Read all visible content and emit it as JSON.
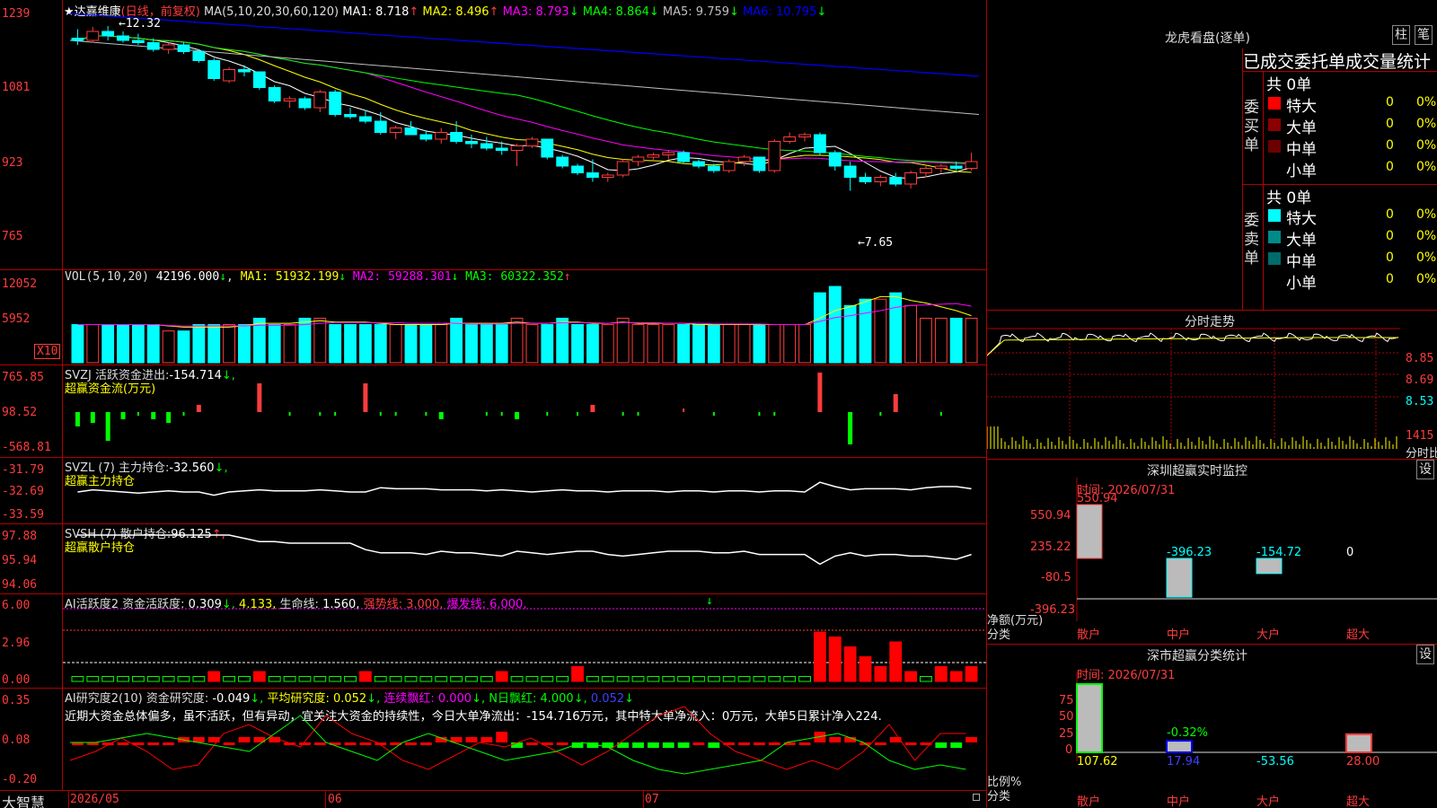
{
  "main": {
    "title": "★达嘉维康",
    "period": "(日线，前复权)",
    "ma_label": "MA(5,10,20,30,60,120)",
    "ma": [
      {
        "label": "MA1:",
        "value": "8.718",
        "arrow": "↑",
        "color": "#ffffff"
      },
      {
        "label": "MA2:",
        "value": "8.496",
        "arrow": "↑",
        "color": "#ffff00"
      },
      {
        "label": "MA3:",
        "value": "8.793",
        "arrow": "↓",
        "color": "#ff00ff"
      },
      {
        "label": "MA4:",
        "value": "8.864",
        "arrow": "↓",
        "color": "#00ff00"
      },
      {
        "label": "MA5:",
        "value": "9.759",
        "arrow": "↓",
        "color": "#c0c0c0"
      },
      {
        "label": "MA6:",
        "value": "10.795",
        "arrow": "↓",
        "color": "#0000ff"
      }
    ],
    "yticks": [
      "1239",
      "1081",
      "923",
      "765"
    ],
    "high_label": "12.32",
    "low_label": "7.65"
  },
  "vol": {
    "label": "VOL(5,10,20)",
    "value": "42196.000",
    "arrow": "↓",
    "ma": [
      {
        "label": "MA1:",
        "value": "51932.199",
        "arrow": "↓",
        "color": "#ffff00"
      },
      {
        "label": "MA2:",
        "value": "59288.301",
        "arrow": "↓",
        "color": "#ff00ff"
      },
      {
        "label": "MA3:",
        "value": "60322.352",
        "arrow": "↑",
        "color": "#00ff00"
      }
    ],
    "yticks": [
      "12052",
      "5952"
    ],
    "unit": "X10"
  },
  "svzj": {
    "label": "SVZJ  活跃资金进出:",
    "value": "-154.714",
    "arrow": "↓,",
    "sub": "超赢资金流(万元)",
    "yticks": [
      "765.85",
      "98.52",
      "-568.81"
    ]
  },
  "svzl": {
    "label": "SVZL (7) 主力持仓:",
    "value": "-32.560",
    "arrow": "↓,",
    "sub": "超赢主力持仓",
    "yticks": [
      "-31.79",
      "-32.69",
      "-33.59"
    ]
  },
  "svsh": {
    "label": "SVSH (7) 散户持仓:",
    "value": "96.125",
    "arrow": "↑,",
    "sub": "超赢散户持仓",
    "yticks": [
      "97.88",
      "95.94",
      "94.06"
    ]
  },
  "ai1": {
    "label": "AI活跃度2 资金活跃度:",
    "v1": "0.309",
    "a1": "↓,",
    "v2": "4.133,",
    "life_label": "生命线:",
    "life": "1.560,",
    "strong": "强势线: 3.000,",
    "burst": "爆发线: 6.000,",
    "flag": "↓",
    "yticks": [
      "6.00",
      "2.96",
      "0.00"
    ]
  },
  "ai2": {
    "label": "AI研究度2(10) 资金研究度:",
    "v1": "-0.049",
    "a1": "↓,",
    "avg": "平均研究度: 0.052",
    "avg_a": "↓,",
    "red": "连续飘红: 0.000",
    "red_a": "↓,",
    "nred": "N日飘红: 4.000",
    "nred_a": "↓,",
    "last": "0.052",
    "last_a": "↓",
    "text": "近期大资金总体偏多，虽不活跃，但有异动，宜关注大资金的持续性，今日大单净流出：-154.716万元，其中特大单净流入：0万元，大单5日累计净入224.",
    "yticks": [
      "0.35",
      "0.08",
      "-0.20"
    ]
  },
  "footer": {
    "brand": "大智慧",
    "dates": [
      "2026/05",
      "06",
      "07"
    ]
  },
  "dragon": {
    "title": "龙虎看盘(逐单)",
    "btn1": "柱",
    "btn2": "笔",
    "header": "已成交委托单成交量统计",
    "buy_label": "委买单",
    "sell_label": "委卖单",
    "buy_total": "共 0单",
    "sell_total": "共 0单",
    "buy_rows": [
      {
        "name": "特大",
        "qty": "0",
        "pct": "0%",
        "color": "#ff0000"
      },
      {
        "name": "大单",
        "qty": "0",
        "pct": "0%",
        "color": "#8b0000"
      },
      {
        "name": "中单",
        "qty": "0",
        "pct": "0%",
        "color": "#6b0000"
      },
      {
        "name": "小单",
        "qty": "0",
        "pct": "0%",
        "color": "#000000"
      }
    ],
    "sell_rows": [
      {
        "name": "特大",
        "qty": "0",
        "pct": "0%",
        "color": "#00ffff"
      },
      {
        "name": "大单",
        "qty": "0",
        "pct": "0%",
        "color": "#008b8b"
      },
      {
        "name": "中单",
        "qty": "0",
        "pct": "0%",
        "color": "#006b6b"
      },
      {
        "name": "小单",
        "qty": "0",
        "pct": "0%",
        "color": "#000000"
      }
    ]
  },
  "intraday": {
    "title": "分时走势",
    "yticks": [
      "8.85",
      "8.69",
      "8.53"
    ],
    "vol_tick": "1415",
    "vol_label": "分时比"
  },
  "monitor": {
    "title": "深圳超赢实时监控",
    "btn": "设",
    "time": "时间: 2026/07/31",
    "yticks": [
      "550.94",
      "235.22",
      "-80.5",
      "-396.23"
    ],
    "ylabel1": "净额(万元)",
    "ylabel2": "分类",
    "cats": [
      "散户",
      "中户",
      "大户",
      "超大"
    ]
  },
  "classify": {
    "title": "深市超赢分类统计",
    "btn": "设",
    "time": "时间: 2026/07/31",
    "yticks": [
      "75",
      "50",
      "25",
      "0"
    ],
    "ylabel1": "比例%",
    "ylabel2": "分类",
    "cats": [
      "散户",
      "中户",
      "大户",
      "超大"
    ]
  },
  "chart_data": [
    {
      "type": "candlestick",
      "title": "达嘉维康 日线 前复权",
      "note": "price axis labels as displayed (x100)",
      "ylim": [
        7.4,
        12.5
      ],
      "ohlc": [
        [
          12.05,
          12.25,
          11.9,
          12.0
        ],
        [
          12.0,
          12.3,
          11.95,
          12.2
        ],
        [
          12.2,
          12.32,
          12.0,
          12.1
        ],
        [
          12.1,
          12.2,
          11.95,
          12.0
        ],
        [
          12.0,
          12.15,
          11.9,
          11.95
        ],
        [
          11.95,
          12.05,
          11.75,
          11.8
        ],
        [
          11.8,
          11.95,
          11.7,
          11.9
        ],
        [
          11.9,
          11.95,
          11.7,
          11.75
        ],
        [
          11.75,
          11.8,
          11.5,
          11.55
        ],
        [
          11.55,
          11.6,
          11.1,
          11.15
        ],
        [
          11.1,
          11.4,
          11.05,
          11.35
        ],
        [
          11.35,
          11.45,
          11.2,
          11.3
        ],
        [
          11.3,
          11.3,
          10.9,
          10.95
        ],
        [
          10.95,
          11.0,
          10.6,
          10.65
        ],
        [
          10.65,
          10.75,
          10.5,
          10.7
        ],
        [
          10.7,
          10.75,
          10.45,
          10.5
        ],
        [
          10.5,
          10.9,
          10.4,
          10.85
        ],
        [
          10.85,
          10.9,
          10.3,
          10.35
        ],
        [
          10.35,
          10.5,
          10.25,
          10.3
        ],
        [
          10.3,
          10.45,
          10.15,
          10.2
        ],
        [
          10.2,
          10.4,
          9.9,
          9.95
        ],
        [
          9.95,
          10.1,
          9.8,
          10.05
        ],
        [
          10.05,
          10.2,
          9.9,
          9.9
        ],
        [
          9.9,
          10.0,
          9.75,
          9.8
        ],
        [
          9.8,
          10.05,
          9.7,
          9.95
        ],
        [
          9.95,
          10.2,
          9.7,
          9.75
        ],
        [
          9.75,
          9.9,
          9.6,
          9.7
        ],
        [
          9.7,
          9.85,
          9.55,
          9.6
        ],
        [
          9.6,
          9.75,
          9.45,
          9.55
        ],
        [
          9.55,
          9.7,
          9.2,
          9.65
        ],
        [
          9.65,
          9.85,
          9.6,
          9.8
        ],
        [
          9.8,
          9.8,
          9.35,
          9.4
        ],
        [
          9.4,
          9.45,
          9.15,
          9.2
        ],
        [
          9.2,
          9.25,
          9.0,
          9.05
        ],
        [
          9.05,
          9.35,
          8.85,
          8.95
        ],
        [
          8.95,
          9.05,
          8.85,
          9.0
        ],
        [
          9.0,
          9.35,
          8.95,
          9.3
        ],
        [
          9.3,
          9.45,
          9.2,
          9.4
        ],
        [
          9.4,
          9.5,
          9.3,
          9.45
        ],
        [
          9.45,
          9.55,
          9.35,
          9.5
        ],
        [
          9.5,
          9.55,
          9.25,
          9.3
        ],
        [
          9.3,
          9.35,
          9.15,
          9.2
        ],
        [
          9.2,
          9.25,
          9.05,
          9.1
        ],
        [
          9.1,
          9.35,
          9.05,
          9.3
        ],
        [
          9.3,
          9.45,
          9.2,
          9.4
        ],
        [
          9.4,
          9.4,
          9.05,
          9.1
        ],
        [
          9.1,
          9.8,
          9.05,
          9.75
        ],
        [
          9.75,
          9.95,
          9.7,
          9.85
        ],
        [
          9.85,
          9.95,
          9.75,
          9.9
        ],
        [
          9.9,
          9.95,
          9.45,
          9.5
        ],
        [
          9.5,
          9.55,
          9.1,
          9.2
        ],
        [
          9.2,
          9.3,
          8.65,
          8.95
        ],
        [
          8.95,
          9.05,
          8.8,
          8.85
        ],
        [
          8.85,
          9.0,
          8.75,
          8.95
        ],
        [
          8.95,
          9.05,
          8.75,
          8.8
        ],
        [
          8.8,
          9.1,
          8.7,
          9.05
        ],
        [
          9.05,
          9.2,
          8.95,
          9.15
        ],
        [
          9.15,
          9.25,
          9.05,
          9.2
        ],
        [
          9.2,
          9.3,
          9.1,
          9.15
        ],
        [
          9.15,
          9.5,
          9.1,
          9.3
        ]
      ]
    },
    {
      "type": "bar",
      "title": "VOL",
      "values": [
        6,
        6,
        6,
        6,
        6,
        6,
        5,
        5,
        6,
        6,
        6,
        6,
        7,
        6,
        6,
        7,
        7,
        6,
        6,
        6,
        6,
        6,
        6,
        6,
        6,
        7,
        6,
        6,
        6,
        7,
        6,
        6,
        7,
        6,
        6,
        6,
        7,
        6,
        6,
        6,
        6,
        6,
        6,
        6,
        6,
        6,
        6,
        6,
        6,
        11,
        12,
        9,
        10,
        10,
        11,
        9,
        7,
        7,
        7,
        7
      ]
    }
  ]
}
